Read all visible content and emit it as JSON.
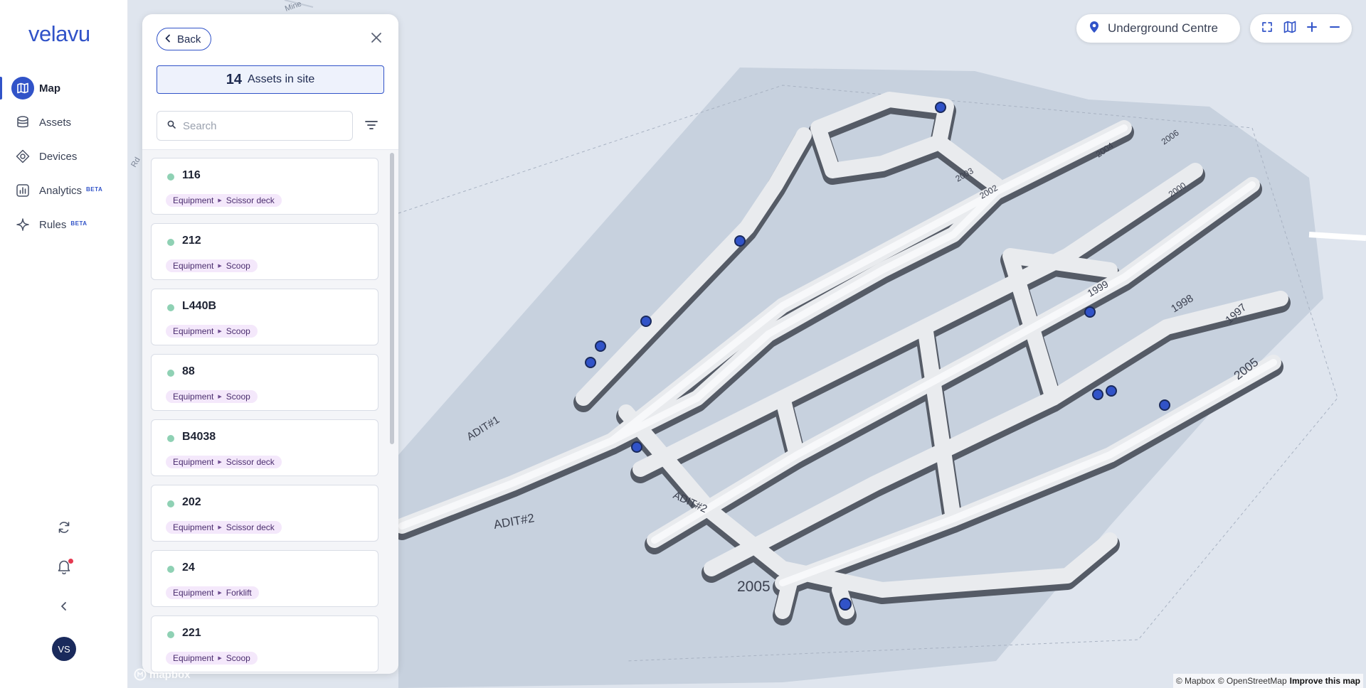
{
  "brand": {
    "logo": "velavu",
    "accent": "#3153c8"
  },
  "nav": {
    "items": [
      {
        "key": "map",
        "label": "Map",
        "icon": "map-icon",
        "active": true,
        "beta": ""
      },
      {
        "key": "assets",
        "label": "Assets",
        "icon": "layers-icon",
        "active": false,
        "beta": ""
      },
      {
        "key": "devices",
        "label": "Devices",
        "icon": "device-icon",
        "active": false,
        "beta": ""
      },
      {
        "key": "analytics",
        "label": "Analytics",
        "icon": "chart-icon",
        "active": false,
        "beta": "BETA"
      },
      {
        "key": "rules",
        "label": "Rules",
        "icon": "sparkle-icon",
        "active": false,
        "beta": "BETA"
      }
    ],
    "user_initials": "VS"
  },
  "panel": {
    "back_label": "Back",
    "asset_count": "14",
    "asset_count_label": "Assets in site",
    "search_placeholder": "Search",
    "assets": [
      {
        "name": "116",
        "category": "Equipment",
        "type": "Scissor deck"
      },
      {
        "name": "212",
        "category": "Equipment",
        "type": "Scoop"
      },
      {
        "name": "L440B",
        "category": "Equipment",
        "type": "Scoop"
      },
      {
        "name": "88",
        "category": "Equipment",
        "type": "Scoop"
      },
      {
        "name": "B4038",
        "category": "Equipment",
        "type": "Scissor deck"
      },
      {
        "name": "202",
        "category": "Equipment",
        "type": "Scissor deck"
      },
      {
        "name": "24",
        "category": "Equipment",
        "type": "Forklift"
      },
      {
        "name": "221",
        "category": "Equipment",
        "type": "Scoop"
      }
    ]
  },
  "map": {
    "location_label": "Underground Centre",
    "road_labels": [
      "Rd",
      "Mine"
    ],
    "tunnel_labels": [
      "ADIT#1",
      "ADIT#2",
      "ADIT#2",
      "2005",
      "2005",
      "1997",
      "1998",
      "1999",
      "2004",
      "2006",
      "2002",
      "2000",
      "2003"
    ],
    "attribution": {
      "mapbox": "© Mapbox",
      "osm": "© OpenStreetMap",
      "improve": "Improve this map",
      "logo": "mapbox"
    }
  }
}
